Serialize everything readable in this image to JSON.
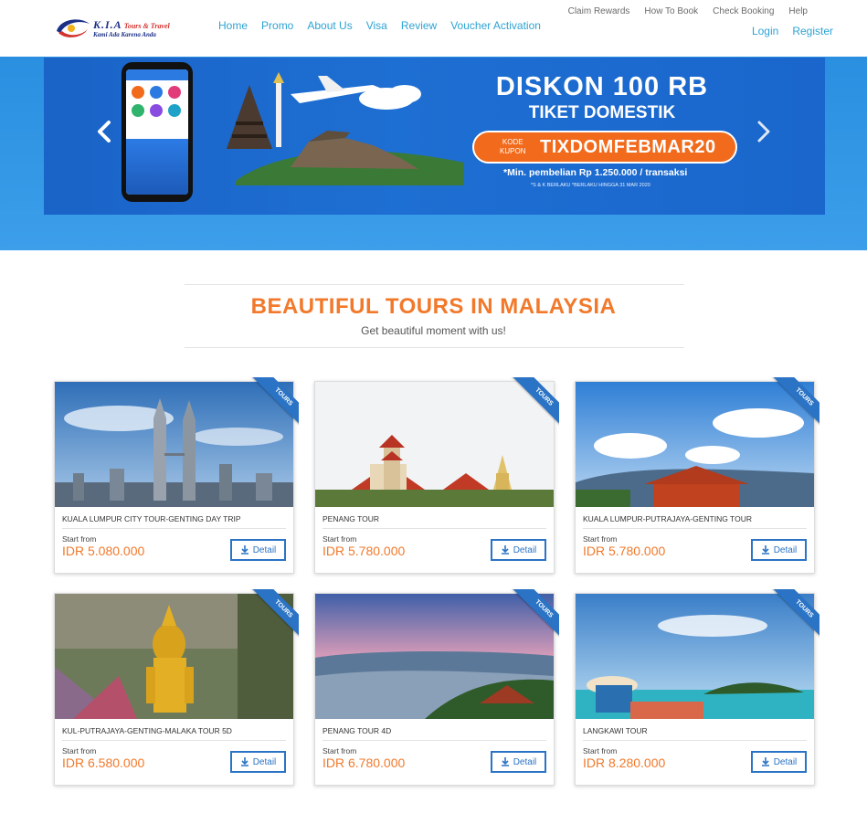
{
  "logo": {
    "brand": "K.I.A",
    "brand_sub": "Tours & Travel",
    "tagline": "Kami Ada Karena Anda"
  },
  "nav": {
    "main": [
      "Home",
      "Promo",
      "About Us",
      "Visa",
      "Review",
      "Voucher Activation"
    ],
    "top": [
      "Claim Rewards",
      "How To Book",
      "Check Booking",
      "Help"
    ],
    "auth": [
      "Login",
      "Register"
    ]
  },
  "banner": {
    "title": "DISKON 100 RB",
    "subtitle": "TIKET DOMESTIK",
    "kode_label_1": "KODE",
    "kode_label_2": "KUPON",
    "coupon_code": "TIXDOMFEBMAR20",
    "note": "*Min. pembelian Rp 1.250.000 / transaksi",
    "fine_print": "*S & K BERLAKU    *BERLAKU HINGGA 31 MAR 2020"
  },
  "section": {
    "title": "BEAUTIFUL TOURS IN MALAYSIA",
    "subtitle": "Get beautiful moment with us!"
  },
  "tours": [
    {
      "name": "KUALA LUMPUR CITY TOUR-GENTING DAY TRIP",
      "start_label": "Start from",
      "price": "IDR 5.080.000",
      "detail_label": "Detail",
      "ribbon": "TOURS"
    },
    {
      "name": "PENANG TOUR",
      "start_label": "Start from",
      "price": "IDR 5.780.000",
      "detail_label": "Detail",
      "ribbon": "TOURS"
    },
    {
      "name": "KUALA LUMPUR-PUTRAJAYA-GENTING TOUR",
      "start_label": "Start from",
      "price": "IDR 5.780.000",
      "detail_label": "Detail",
      "ribbon": "TOURS"
    },
    {
      "name": "KUL-PUTRAJAYA-GENTING-MALAKA TOUR 5D",
      "start_label": "Start from",
      "price": "IDR 6.580.000",
      "detail_label": "Detail",
      "ribbon": "TOURS"
    },
    {
      "name": "PENANG TOUR 4D",
      "start_label": "Start from",
      "price": "IDR 6.780.000",
      "detail_label": "Detail",
      "ribbon": "TOURS"
    },
    {
      "name": "LANGKAWI TOUR",
      "start_label": "Start from",
      "price": "IDR 8.280.000",
      "detail_label": "Detail",
      "ribbon": "TOURS"
    }
  ],
  "colors": {
    "accent": "#f2792b",
    "link": "#2ea3d3",
    "ribbon": "#2a73c5"
  }
}
